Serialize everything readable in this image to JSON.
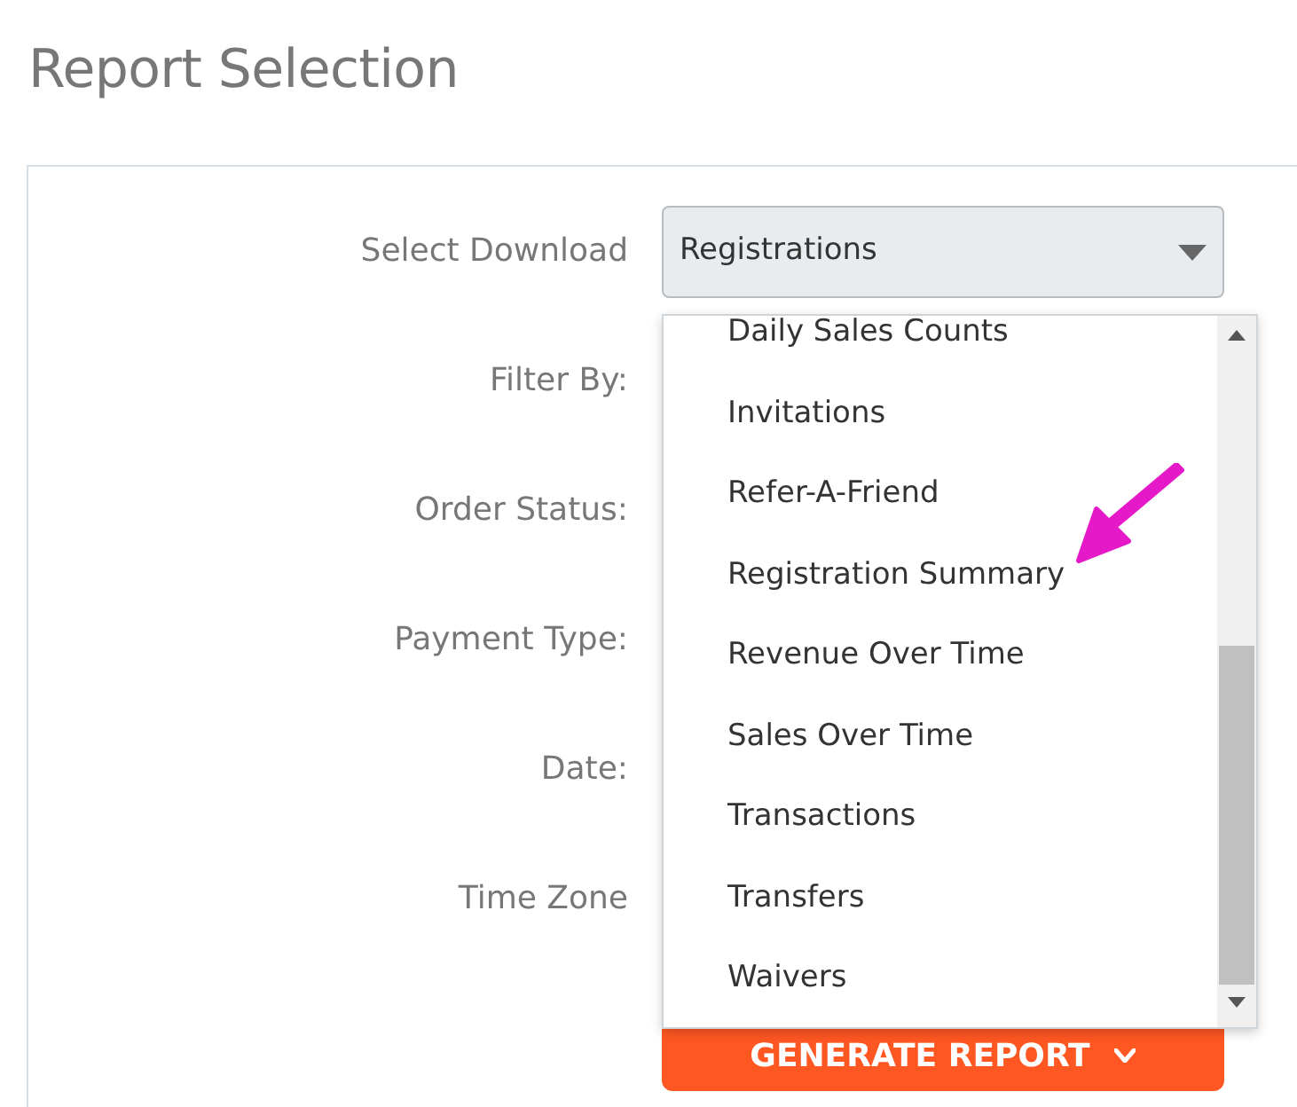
{
  "page_title": "Report Selection",
  "form": {
    "fields": [
      {
        "label": "Select Download",
        "value": "Registrations"
      },
      {
        "label": "Filter By:"
      },
      {
        "label": "Order Status:"
      },
      {
        "label": "Payment Type:"
      },
      {
        "label": "Date:"
      },
      {
        "label": "Time Zone"
      }
    ],
    "button": "GENERATE REPORT"
  },
  "dropdown": {
    "options": [
      "Daily Sales Counts",
      "Invitations",
      "Refer-A-Friend",
      "Registration Summary",
      "Revenue Over Time",
      "Sales Over Time",
      "Transactions",
      "Transfers",
      "Waivers"
    ]
  }
}
